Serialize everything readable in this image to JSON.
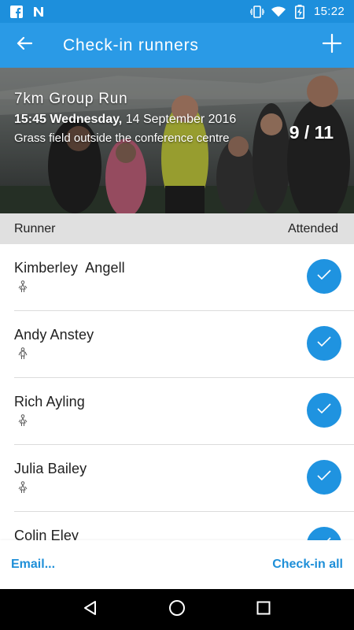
{
  "status_bar": {
    "time": "15:22",
    "left_icons": [
      "facebook-icon",
      "n-notification-icon"
    ],
    "right_icons": [
      "vibrate-icon",
      "wifi-icon",
      "battery-charging-icon"
    ]
  },
  "app_bar": {
    "title": "Check-in runners",
    "back_icon": "arrow-back-icon",
    "add_icon": "plus-icon",
    "color": "#2a9ae6"
  },
  "event": {
    "name": "7km Group Run",
    "time": "15:45 Wednesday,",
    "date": "14 September 2016",
    "location": "Grass field outside the conference centre",
    "attendance": "9 / 11"
  },
  "columns": {
    "runner": "Runner",
    "attended": "Attended"
  },
  "runners": [
    {
      "name": "Kimberley  Angell",
      "gender_icon": "female-icon",
      "attended": true
    },
    {
      "name": "Andy Anstey",
      "gender_icon": "male-icon",
      "attended": true
    },
    {
      "name": "Rich Ayling",
      "gender_icon": "female-icon",
      "attended": true
    },
    {
      "name": "Julia Bailey",
      "gender_icon": "female-icon",
      "attended": true
    },
    {
      "name": "Colin Eley",
      "gender_icon": "male-icon",
      "attended": true
    }
  ],
  "footer": {
    "email_label": "Email...",
    "checkin_all_label": "Check-in all",
    "accent": "#1e8fd8"
  },
  "nav_bar": {
    "buttons": [
      "back-triangle-icon",
      "home-circle-icon",
      "recents-square-icon"
    ]
  }
}
